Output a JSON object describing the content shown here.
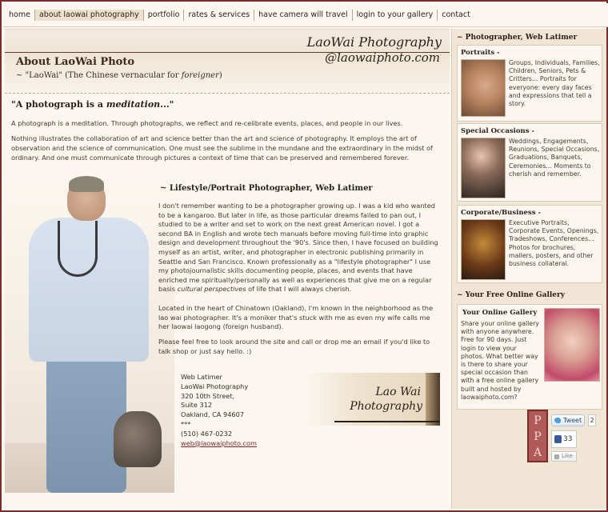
{
  "nav": {
    "items": [
      "home",
      "about laowai photography",
      "portfolio",
      "rates & services",
      "have camera will travel",
      "login to your gallery",
      "contact"
    ],
    "active_index": 1
  },
  "header": {
    "brand_title": "LaoWai Photography",
    "brand_handle": "@laowaiphoto.com",
    "page_title": "About LaoWai Photo",
    "subtitle_prefix": "~ \"LaoWai\" (The Chinese vernacular for ",
    "subtitle_italic": "foreigner",
    "subtitle_suffix": ")"
  },
  "intro": {
    "quote_prefix": "\"A photograph is a ",
    "quote_italic": "meditation",
    "quote_suffix": "...\"",
    "para1": "A photograph is a meditation. Through photographs, we reflect and re-celibrate events, places, and people in our lives.",
    "para2": "Nothing illustrates the collaboration of art and science better than the art and science of photography. It employs the art of observation and the science of communication. One must see the sublime in the mundane and the extraordinary in the midst of ordinary. And one must communicate through pictures a context of time that can be preserved and remembered forever."
  },
  "bio": {
    "heading": "~ Lifestyle/Portrait Photographer, Web Latimer",
    "p1_a": "I don't remember wanting to be a photographer growing up. I was a kid who wanted to be a kangaroo. But later in life, as those particular dreams failed to pan out, I studied to be a writer and set to work on the next great American novel. I got a second BA in English and wrote tech manuals before moving full-time into graphic design and development throughout the '90's. Since then, I have focused on building myself as an artist, writer, and photographer in electronic publishing primarily in Seattle and San Francisco. Known professionally as a \"lifestyle photographer\" I use my photojournalistic skills documenting people, places, and events that have enriched me spiritually/personally as well as experiences that give me on a regular basis ",
    "p1_italic": "cultural perspectives",
    "p1_b": " of life that I will always cherish.",
    "p2": "Located in the heart of Chinatown (Oakland), I'm known in the neighborhood as the lao wai photographer. It's a moniker that's stuck with me as even my wife calls me her laowai laogong (foreign husband).",
    "p3": "Please feel free to look around the site and call or drop me an email if you'd like to talk shop or just say hello. :)"
  },
  "address": {
    "name": "Web Latimer",
    "company": "LaoWai Photography",
    "street": "320 10th Street,",
    "suite": "Suite 312",
    "city": "Oakland, CA 94607",
    "sep": "***",
    "phone": "(510) 467-0232",
    "email": "web@laowaiphoto.com"
  },
  "logo": {
    "line1": "Lao Wai",
    "line2": "Photography"
  },
  "sidebar": {
    "heading1": "~ Photographer, Web Latimer",
    "cards": [
      {
        "title": "Portraits -",
        "text": "Groups, Individuals, Families, Children, Seniors, Pets & Critters... Portraits for everyone: every day faces and expressions that tell a story.",
        "thumb": "thumb-portrait"
      },
      {
        "title": "Special Occasions -",
        "text": "Weddings, Engagements, Reunions, Special Occasions, Graduations, Banquets, Ceremonies... Moments to cherish and remember.",
        "thumb": "thumb-wedding"
      },
      {
        "title": "Corporate/Business -",
        "text": "Executive Portraits, Corporate Events, Openings, Tradeshows, Conferences... Photos for brochures, mailers, posters, and other business collateral.",
        "thumb": "thumb-corp"
      }
    ],
    "heading2": "~ Your Free Online Gallery",
    "gallery": {
      "title": "Your Online Gallery",
      "text": "Share your online gallery with anyone anywhere. Free for 90 days. Just login to view your photos. What better way is there to share your special occasion than with a free online gallery built and hosted by laowaiphoto.com?"
    },
    "ppa": "PPA",
    "tweet_label": "Tweet",
    "tweet_count": "2",
    "fb_count": "33",
    "fb_like_label": "Like"
  },
  "colors": {
    "frame": "#7b2c2c",
    "accent": "#7b2c2c",
    "bg": "#fbf7f0",
    "sidebar": "#f1e6d5"
  }
}
